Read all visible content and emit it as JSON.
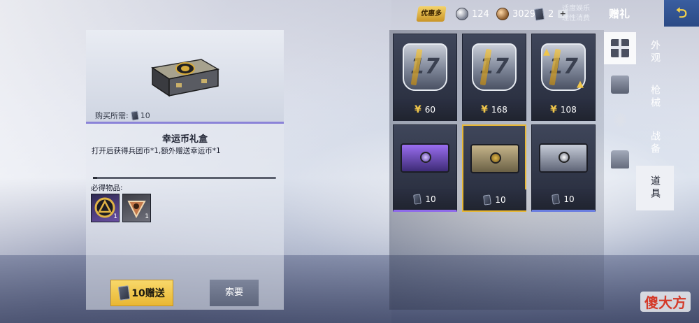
{
  "topbar": {
    "promo_label": "优惠多",
    "silver_amount": "124",
    "bronze_amount": "3029",
    "card_amount": "2",
    "notice_line1": "适度娱乐",
    "notice_line2": "理性消费",
    "title": "赠礼",
    "back_symbol": "⮌"
  },
  "left": {
    "price_label": "购买所需:",
    "price_value": "10",
    "item_title": "幸运币礼盒",
    "item_desc": "打开后获得兵团币*1,额外赠送幸运币*1",
    "must_label": "必得物品:",
    "must_items": [
      {
        "count": "1"
      },
      {
        "count": "1"
      }
    ],
    "send_label": "10赠送",
    "ask_label": "索要"
  },
  "grid": {
    "items": [
      {
        "price": "60",
        "currency": "yen"
      },
      {
        "price": "168",
        "currency": "yen"
      },
      {
        "price": "108",
        "currency": "yen"
      },
      {
        "price": "10",
        "currency": "card"
      },
      {
        "price": "10",
        "currency": "card"
      },
      {
        "price": "10",
        "currency": "card"
      }
    ],
    "badge_text": "17",
    "yen_symbol": "¥"
  },
  "tabs": {
    "text": [
      "外观",
      "枪械",
      "战备",
      "道具"
    ]
  },
  "watermark": "傻大方",
  "colors": {
    "gold": "#e7b735",
    "purple": "#8f6bea",
    "blue": "#6b7ee0"
  }
}
